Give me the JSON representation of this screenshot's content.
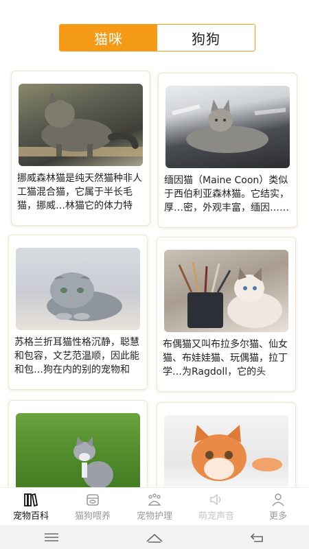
{
  "segment": {
    "tabs": [
      {
        "label": "猫咪",
        "active": true
      },
      {
        "label": "狗狗",
        "active": false
      }
    ],
    "accent_color": "#f59a16"
  },
  "cards": [
    {
      "desc": "挪威森林猫是纯天然猫种非人工猫混合猫，它属于半长毛猫，挪威…林猫它的体力特别……"
    },
    {
      "desc": "缅因猫（Maine Coon）类似于西伯利亚森林猫。它结实，厚…密，外观丰富，缅因……"
    },
    {
      "desc": "苏格兰折耳猫性格沉静，聪慧和包容，文艺范温顺，因此能和包…狗在内的别的宠物和平……"
    },
    {
      "desc": "布偶猫又叫布拉多尔猫、仙女猫、布娃娃猫、玩偶猫，拉丁学…为Ragdoll，它的头是……"
    },
    {
      "desc": ""
    },
    {
      "desc": ""
    }
  ],
  "tabbar": {
    "items": [
      {
        "label": "宠物百科",
        "icon": "book-icon",
        "state": "active"
      },
      {
        "label": "猫狗喂养",
        "icon": "food-bowl-icon",
        "state": "normal"
      },
      {
        "label": "宠物护理",
        "icon": "paw-icon",
        "state": "normal"
      },
      {
        "label": "萌宠声音",
        "icon": "speaker-icon",
        "state": "dim"
      },
      {
        "label": "更多",
        "icon": "person-icon",
        "state": "normal"
      }
    ]
  },
  "system_nav": {
    "buttons": [
      "menu-icon",
      "home-icon",
      "back-icon"
    ]
  }
}
